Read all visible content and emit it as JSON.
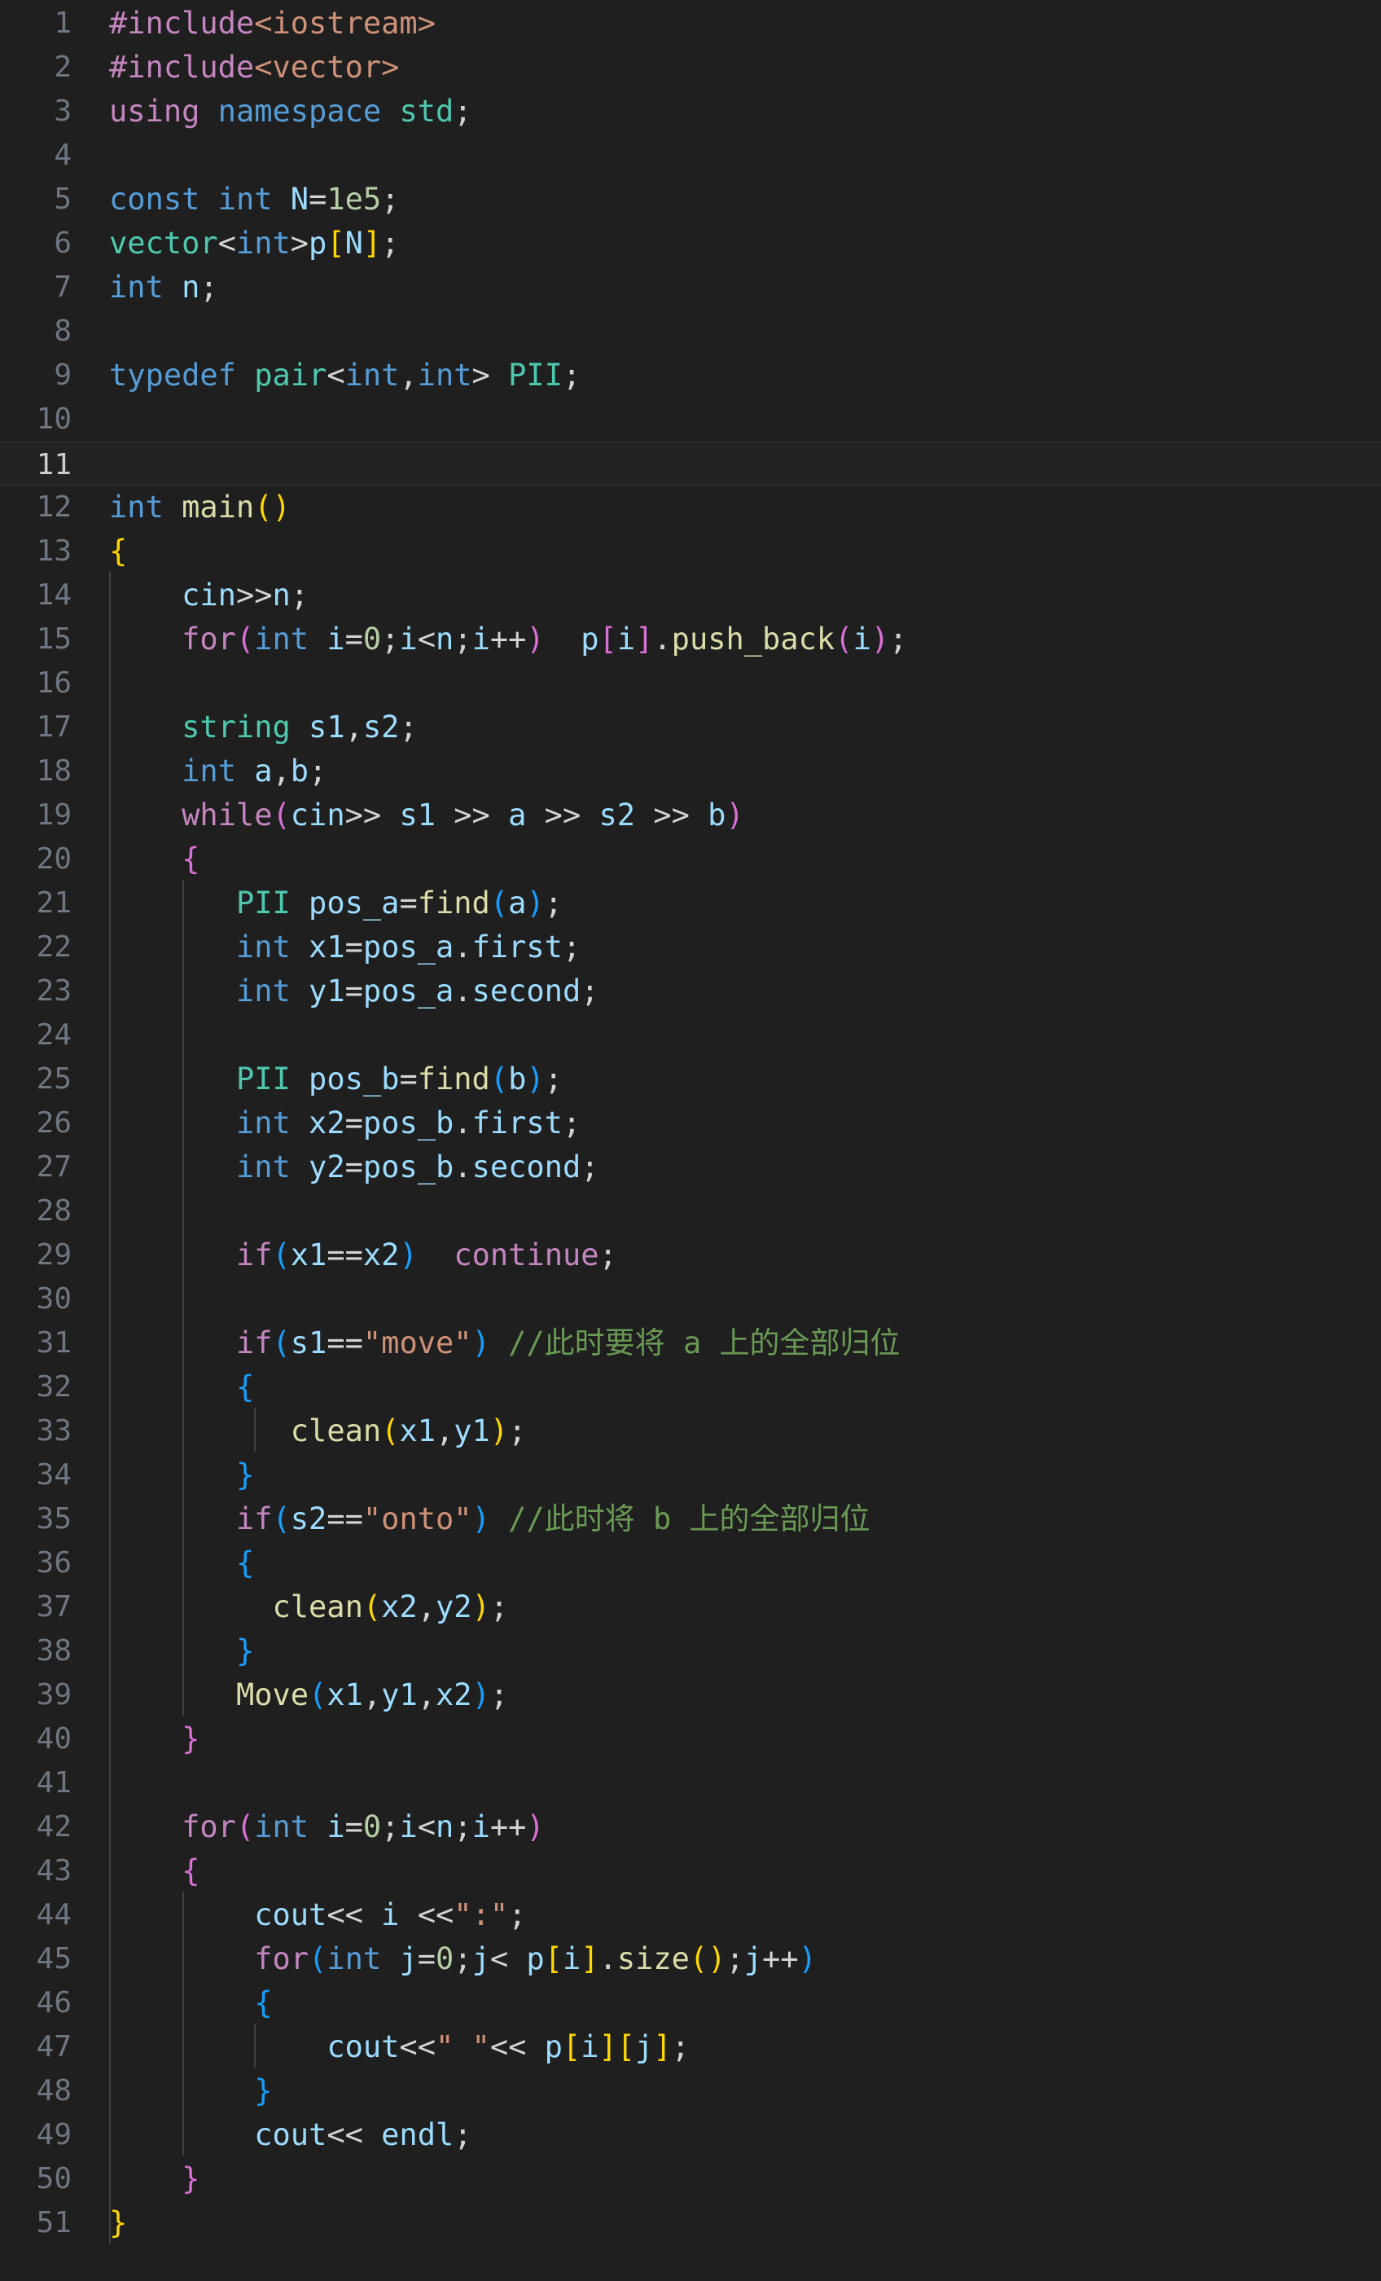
{
  "editor": {
    "current_line": 11,
    "lines": [
      [
        [
          "ctl",
          "#include"
        ],
        [
          "str",
          "<iostream>"
        ]
      ],
      [
        [
          "ctl",
          "#include"
        ],
        [
          "str",
          "<vector>"
        ]
      ],
      [
        [
          "ctl",
          "using"
        ],
        [
          "pu",
          " "
        ],
        [
          "kw",
          "namespace"
        ],
        [
          "pu",
          " "
        ],
        [
          "ns",
          "std"
        ],
        [
          "pu",
          ";"
        ]
      ],
      [],
      [
        [
          "kw",
          "const"
        ],
        [
          "pu",
          " "
        ],
        [
          "kw",
          "int"
        ],
        [
          "pu",
          " "
        ],
        [
          "var",
          "N"
        ],
        [
          "pu",
          "="
        ],
        [
          "num",
          "1e5"
        ],
        [
          "pu",
          ";"
        ]
      ],
      [
        [
          "ty",
          "vector"
        ],
        [
          "pu",
          "<"
        ],
        [
          "kw",
          "int"
        ],
        [
          "pu",
          ">"
        ],
        [
          "var",
          "p"
        ],
        [
          "br1",
          "["
        ],
        [
          "var",
          "N"
        ],
        [
          "br1",
          "]"
        ],
        [
          "pu",
          ";"
        ]
      ],
      [
        [
          "kw",
          "int"
        ],
        [
          "pu",
          " "
        ],
        [
          "var",
          "n"
        ],
        [
          "pu",
          ";"
        ]
      ],
      [],
      [
        [
          "kw",
          "typedef"
        ],
        [
          "pu",
          " "
        ],
        [
          "ty",
          "pair"
        ],
        [
          "pu",
          "<"
        ],
        [
          "kw",
          "int"
        ],
        [
          "pu",
          ","
        ],
        [
          "kw",
          "int"
        ],
        [
          "pu",
          "> "
        ],
        [
          "ty",
          "PII"
        ],
        [
          "pu",
          ";"
        ]
      ],
      [],
      [],
      [
        [
          "kw",
          "int"
        ],
        [
          "pu",
          " "
        ],
        [
          "fn",
          "main"
        ],
        [
          "br1",
          "()"
        ]
      ],
      [
        [
          "br1",
          "{"
        ]
      ],
      [
        [
          "pu",
          "    "
        ],
        [
          "var",
          "cin"
        ],
        [
          "pu",
          ">>"
        ],
        [
          "var",
          "n"
        ],
        [
          "pu",
          ";"
        ]
      ],
      [
        [
          "pu",
          "    "
        ],
        [
          "ctl",
          "for"
        ],
        [
          "br2",
          "("
        ],
        [
          "kw",
          "int"
        ],
        [
          "pu",
          " "
        ],
        [
          "var",
          "i"
        ],
        [
          "pu",
          "="
        ],
        [
          "num",
          "0"
        ],
        [
          "pu",
          ";"
        ],
        [
          "var",
          "i"
        ],
        [
          "pu",
          "<"
        ],
        [
          "var",
          "n"
        ],
        [
          "pu",
          ";"
        ],
        [
          "var",
          "i"
        ],
        [
          "pu",
          "++"
        ],
        [
          "br2",
          ")"
        ],
        [
          "pu",
          "  "
        ],
        [
          "var",
          "p"
        ],
        [
          "br2",
          "["
        ],
        [
          "var",
          "i"
        ],
        [
          "br2",
          "]"
        ],
        [
          "pu",
          "."
        ],
        [
          "fn",
          "push_back"
        ],
        [
          "br2",
          "("
        ],
        [
          "var",
          "i"
        ],
        [
          "br2",
          ")"
        ],
        [
          "pu",
          ";"
        ]
      ],
      [],
      [
        [
          "pu",
          "    "
        ],
        [
          "ty",
          "string"
        ],
        [
          "pu",
          " "
        ],
        [
          "var",
          "s1"
        ],
        [
          "pu",
          ","
        ],
        [
          "var",
          "s2"
        ],
        [
          "pu",
          ";"
        ]
      ],
      [
        [
          "pu",
          "    "
        ],
        [
          "kw",
          "int"
        ],
        [
          "pu",
          " "
        ],
        [
          "var",
          "a"
        ],
        [
          "pu",
          ","
        ],
        [
          "var",
          "b"
        ],
        [
          "pu",
          ";"
        ]
      ],
      [
        [
          "pu",
          "    "
        ],
        [
          "ctl",
          "while"
        ],
        [
          "br2",
          "("
        ],
        [
          "var",
          "cin"
        ],
        [
          "pu",
          ">> "
        ],
        [
          "var",
          "s1"
        ],
        [
          "pu",
          " >> "
        ],
        [
          "var",
          "a"
        ],
        [
          "pu",
          " >> "
        ],
        [
          "var",
          "s2"
        ],
        [
          "pu",
          " >> "
        ],
        [
          "var",
          "b"
        ],
        [
          "br2",
          ")"
        ]
      ],
      [
        [
          "pu",
          "    "
        ],
        [
          "br2",
          "{"
        ]
      ],
      [
        [
          "pu",
          "       "
        ],
        [
          "ty",
          "PII"
        ],
        [
          "pu",
          " "
        ],
        [
          "var",
          "pos_a"
        ],
        [
          "pu",
          "="
        ],
        [
          "fn",
          "find"
        ],
        [
          "br3",
          "("
        ],
        [
          "var",
          "a"
        ],
        [
          "br3",
          ")"
        ],
        [
          "pu",
          ";"
        ]
      ],
      [
        [
          "pu",
          "       "
        ],
        [
          "kw",
          "int"
        ],
        [
          "pu",
          " "
        ],
        [
          "var",
          "x1"
        ],
        [
          "pu",
          "="
        ],
        [
          "var",
          "pos_a"
        ],
        [
          "pu",
          "."
        ],
        [
          "var",
          "first"
        ],
        [
          "pu",
          ";"
        ]
      ],
      [
        [
          "pu",
          "       "
        ],
        [
          "kw",
          "int"
        ],
        [
          "pu",
          " "
        ],
        [
          "var",
          "y1"
        ],
        [
          "pu",
          "="
        ],
        [
          "var",
          "pos_a"
        ],
        [
          "pu",
          "."
        ],
        [
          "var",
          "second"
        ],
        [
          "pu",
          ";"
        ]
      ],
      [],
      [
        [
          "pu",
          "       "
        ],
        [
          "ty",
          "PII"
        ],
        [
          "pu",
          " "
        ],
        [
          "var",
          "pos_b"
        ],
        [
          "pu",
          "="
        ],
        [
          "fn",
          "find"
        ],
        [
          "br3",
          "("
        ],
        [
          "var",
          "b"
        ],
        [
          "br3",
          ")"
        ],
        [
          "pu",
          ";"
        ]
      ],
      [
        [
          "pu",
          "       "
        ],
        [
          "kw",
          "int"
        ],
        [
          "pu",
          " "
        ],
        [
          "var",
          "x2"
        ],
        [
          "pu",
          "="
        ],
        [
          "var",
          "pos_b"
        ],
        [
          "pu",
          "."
        ],
        [
          "var",
          "first"
        ],
        [
          "pu",
          ";"
        ]
      ],
      [
        [
          "pu",
          "       "
        ],
        [
          "kw",
          "int"
        ],
        [
          "pu",
          " "
        ],
        [
          "var",
          "y2"
        ],
        [
          "pu",
          "="
        ],
        [
          "var",
          "pos_b"
        ],
        [
          "pu",
          "."
        ],
        [
          "var",
          "second"
        ],
        [
          "pu",
          ";"
        ]
      ],
      [],
      [
        [
          "pu",
          "       "
        ],
        [
          "ctl",
          "if"
        ],
        [
          "br3",
          "("
        ],
        [
          "var",
          "x1"
        ],
        [
          "pu",
          "=="
        ],
        [
          "var",
          "x2"
        ],
        [
          "br3",
          ")"
        ],
        [
          "pu",
          "  "
        ],
        [
          "ctl",
          "continue"
        ],
        [
          "pu",
          ";"
        ]
      ],
      [],
      [
        [
          "pu",
          "       "
        ],
        [
          "ctl",
          "if"
        ],
        [
          "br3",
          "("
        ],
        [
          "var",
          "s1"
        ],
        [
          "pu",
          "=="
        ],
        [
          "str",
          "\"move\""
        ],
        [
          "br3",
          ")"
        ],
        [
          "pu",
          " "
        ],
        [
          "cmt",
          "//此时要将 a 上的全部归位"
        ]
      ],
      [
        [
          "pu",
          "       "
        ],
        [
          "br3",
          "{"
        ]
      ],
      [
        [
          "pu",
          "          "
        ],
        [
          "fn",
          "clean"
        ],
        [
          "br1",
          "("
        ],
        [
          "var",
          "x1"
        ],
        [
          "pu",
          ","
        ],
        [
          "var",
          "y1"
        ],
        [
          "br1",
          ")"
        ],
        [
          "pu",
          ";"
        ]
      ],
      [
        [
          "pu",
          "       "
        ],
        [
          "br3",
          "}"
        ]
      ],
      [
        [
          "pu",
          "       "
        ],
        [
          "ctl",
          "if"
        ],
        [
          "br3",
          "("
        ],
        [
          "var",
          "s2"
        ],
        [
          "pu",
          "=="
        ],
        [
          "str",
          "\"onto\""
        ],
        [
          "br3",
          ")"
        ],
        [
          "pu",
          " "
        ],
        [
          "cmt",
          "//此时将 b 上的全部归位"
        ]
      ],
      [
        [
          "pu",
          "       "
        ],
        [
          "br3",
          "{"
        ]
      ],
      [
        [
          "pu",
          "         "
        ],
        [
          "fn",
          "clean"
        ],
        [
          "br1",
          "("
        ],
        [
          "var",
          "x2"
        ],
        [
          "pu",
          ","
        ],
        [
          "var",
          "y2"
        ],
        [
          "br1",
          ")"
        ],
        [
          "pu",
          ";"
        ]
      ],
      [
        [
          "pu",
          "       "
        ],
        [
          "br3",
          "}"
        ]
      ],
      [
        [
          "pu",
          "       "
        ],
        [
          "fn",
          "Move"
        ],
        [
          "br3",
          "("
        ],
        [
          "var",
          "x1"
        ],
        [
          "pu",
          ","
        ],
        [
          "var",
          "y1"
        ],
        [
          "pu",
          ","
        ],
        [
          "var",
          "x2"
        ],
        [
          "br3",
          ")"
        ],
        [
          "pu",
          ";"
        ]
      ],
      [
        [
          "pu",
          "    "
        ],
        [
          "br2",
          "}"
        ]
      ],
      [],
      [
        [
          "pu",
          "    "
        ],
        [
          "ctl",
          "for"
        ],
        [
          "br2",
          "("
        ],
        [
          "kw",
          "int"
        ],
        [
          "pu",
          " "
        ],
        [
          "var",
          "i"
        ],
        [
          "pu",
          "="
        ],
        [
          "num",
          "0"
        ],
        [
          "pu",
          ";"
        ],
        [
          "var",
          "i"
        ],
        [
          "pu",
          "<"
        ],
        [
          "var",
          "n"
        ],
        [
          "pu",
          ";"
        ],
        [
          "var",
          "i"
        ],
        [
          "pu",
          "++"
        ],
        [
          "br2",
          ")"
        ]
      ],
      [
        [
          "pu",
          "    "
        ],
        [
          "br2",
          "{"
        ]
      ],
      [
        [
          "pu",
          "        "
        ],
        [
          "var",
          "cout"
        ],
        [
          "pu",
          "<< "
        ],
        [
          "var",
          "i"
        ],
        [
          "pu",
          " <<"
        ],
        [
          "str",
          "\":\""
        ],
        [
          "pu",
          ";"
        ]
      ],
      [
        [
          "pu",
          "        "
        ],
        [
          "ctl",
          "for"
        ],
        [
          "br3",
          "("
        ],
        [
          "kw",
          "int"
        ],
        [
          "pu",
          " "
        ],
        [
          "var",
          "j"
        ],
        [
          "pu",
          "="
        ],
        [
          "num",
          "0"
        ],
        [
          "pu",
          ";"
        ],
        [
          "var",
          "j"
        ],
        [
          "pu",
          "< "
        ],
        [
          "var",
          "p"
        ],
        [
          "br1",
          "["
        ],
        [
          "var",
          "i"
        ],
        [
          "br1",
          "]"
        ],
        [
          "pu",
          "."
        ],
        [
          "fn",
          "size"
        ],
        [
          "br1",
          "()"
        ],
        [
          "pu",
          ";"
        ],
        [
          "var",
          "j"
        ],
        [
          "pu",
          "++"
        ],
        [
          "br3",
          ")"
        ]
      ],
      [
        [
          "pu",
          "        "
        ],
        [
          "br3",
          "{"
        ]
      ],
      [
        [
          "pu",
          "            "
        ],
        [
          "var",
          "cout"
        ],
        [
          "pu",
          "<<"
        ],
        [
          "str",
          "\" \""
        ],
        [
          "pu",
          "<< "
        ],
        [
          "var",
          "p"
        ],
        [
          "br1",
          "["
        ],
        [
          "var",
          "i"
        ],
        [
          "br1",
          "]["
        ],
        [
          "var",
          "j"
        ],
        [
          "br1",
          "]"
        ],
        [
          "pu",
          ";"
        ]
      ],
      [
        [
          "pu",
          "        "
        ],
        [
          "br3",
          "}"
        ]
      ],
      [
        [
          "pu",
          "        "
        ],
        [
          "var",
          "cout"
        ],
        [
          "pu",
          "<< "
        ],
        [
          "var",
          "endl"
        ],
        [
          "pu",
          ";"
        ]
      ],
      [
        [
          "pu",
          "    "
        ],
        [
          "br2",
          "}"
        ]
      ],
      [
        [
          "br1",
          "}"
        ]
      ]
    ]
  }
}
